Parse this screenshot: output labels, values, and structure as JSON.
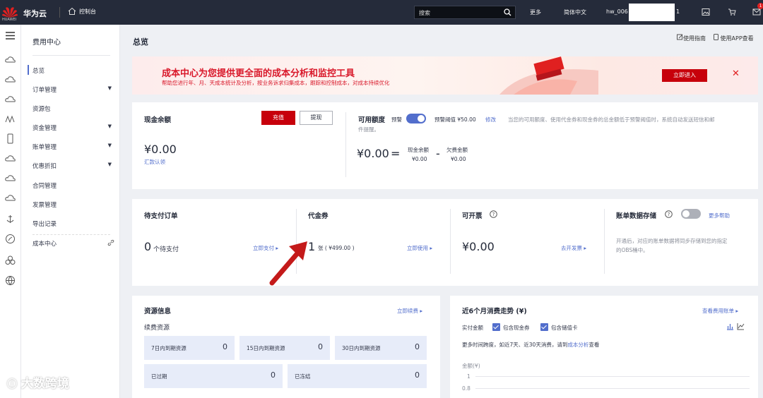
{
  "topbar": {
    "brand": "华为云",
    "logo_text": "HUAWEI",
    "console": "控制台",
    "search_placeholder": "搜索",
    "more": "更多",
    "language": "简体中文",
    "user": "hw_006",
    "user_suffix": "1",
    "badge": "1"
  },
  "sidebar": {
    "title": "费用中心",
    "items": [
      {
        "label": "总览",
        "caret": false
      },
      {
        "label": "订单管理",
        "caret": true
      },
      {
        "label": "资源包",
        "caret": false
      },
      {
        "label": "资金管理",
        "caret": true
      },
      {
        "label": "账单管理",
        "caret": true
      },
      {
        "label": "优惠折扣",
        "caret": true
      },
      {
        "label": "合同管理",
        "caret": false
      },
      {
        "label": "发票管理",
        "caret": false
      },
      {
        "label": "导出记录",
        "caret": false
      },
      {
        "label": "成本中心",
        "caret": false
      }
    ]
  },
  "page": {
    "title": "总览",
    "guide_link": "使用指南",
    "app_link": "使用APP查看"
  },
  "banner": {
    "title": "成本中心为您提供更全面的成本分析和监控工具",
    "subtitle": "帮助您进行年、月、天成本统计及分析，按业务诉求归集成本，跟踪和控制成本，对成本持续优化",
    "button": "立即进入"
  },
  "cash": {
    "title": "现金余额",
    "recharge": "充值",
    "withdraw": "提现",
    "amount": "¥0.00",
    "remit_link": "汇款认领"
  },
  "credit": {
    "title": "可用额度",
    "alert_label": "预警",
    "threshold_label": "预警阈值 ¥50.00",
    "edit": "修改",
    "desc_line1": "当您的可用额度、使用代金券和现金券的总金额低于预警阈值时，系统自动发送短信和邮",
    "desc_line2": "件提醒。",
    "amount": "¥0.00",
    "eq": "=",
    "cash_label": "现金余额",
    "cash_value": "¥0.00",
    "minus": "-",
    "owed_label": "欠费金额",
    "owed_value": "¥0.00"
  },
  "pending": {
    "title": "待支付订单",
    "count": "0",
    "count_unit": "个待支付",
    "link": "立即支付 ▸"
  },
  "coupon": {
    "title": "代金券",
    "count": "1",
    "detail": "张 ( ¥499.00 )",
    "link": "立即使用 ▸"
  },
  "invoice": {
    "title": "可开票",
    "amount": "¥0.00",
    "link": "去开发票 ▸"
  },
  "storage": {
    "title": "账单数据存储",
    "help_link": "更多帮助",
    "desc_line1": "开通后，对应的账单数据将同步存储到您的指定",
    "desc_line2": "的OBS桶中。"
  },
  "resources": {
    "title": "资源信息",
    "renew_link": "立即续费 ▸",
    "subtitle": "续费资源",
    "boxes": [
      {
        "label": "7日内到期资源",
        "value": "0"
      },
      {
        "label": "15日内到期资源",
        "value": "0"
      },
      {
        "label": "30日内到期资源",
        "value": "0"
      },
      {
        "label": "已过期",
        "value": "0"
      },
      {
        "label": "已冻结",
        "value": "0"
      }
    ]
  },
  "trend": {
    "title": "近6个月消费走势 (¥)",
    "view_link": "查看费用账单 ▸",
    "actual_label": "实付金额",
    "include_cash": "包含现金券",
    "include_stored": "包含储值卡",
    "hint_prefix": "更多时间跨度，如近7天、近30天消费，请到",
    "hint_link": "成本分析",
    "hint_suffix": "查看",
    "y_label": "金额(¥)",
    "ticks": [
      "1",
      "0.8"
    ]
  },
  "watermark": "大数跨境",
  "colors": {
    "topbar": "#252b3a",
    "brand_red": "#c7000b",
    "link_blue": "#526ecc",
    "toggle_on": "#526ecc",
    "toggle_off": "#adb0b8",
    "resource_box": "#e7ecf9"
  }
}
